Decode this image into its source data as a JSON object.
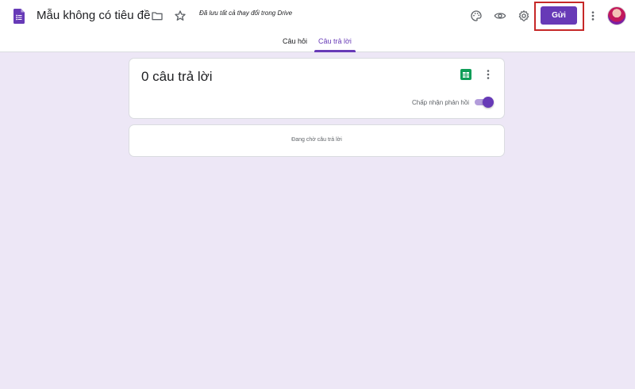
{
  "header": {
    "title": "Mẫu không có tiêu đề",
    "save_status": "Đã lưu tất cả thay đổi trong Drive",
    "send_label": "Gửi",
    "icons": [
      "forms-logo-icon",
      "folder-icon",
      "star-icon",
      "palette-icon",
      "eye-icon",
      "gear-icon",
      "more-vert-icon"
    ]
  },
  "tabs": [
    {
      "label": "Câu hỏi",
      "active": false
    },
    {
      "label": "Câu trả lời",
      "active": true
    }
  ],
  "summary": {
    "count_label": "0 câu trả lời",
    "accept_label": "Chấp nhận phản hồi",
    "accepting": true
  },
  "waiting": {
    "text": "Đang chờ câu trả lời"
  },
  "colors": {
    "accent": "#673ab7",
    "background": "#ede7f6",
    "highlight": "#c62828",
    "sheets": "#0f9d58"
  }
}
